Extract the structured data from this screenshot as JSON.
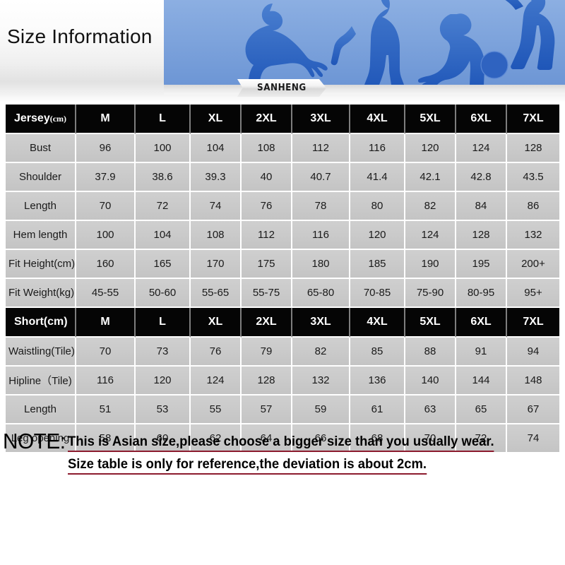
{
  "banner": {
    "title": "Size Information",
    "logo": "SANHENG",
    "accent_blue": "#7ba2db",
    "art_description": "basketball-player-silhouettes"
  },
  "jersey_table": {
    "header": {
      "label": "Jersey",
      "unit": "(cm)",
      "sizes": [
        "M",
        "L",
        "XL",
        "2XL",
        "3XL",
        "4XL",
        "5XL",
        "6XL",
        "7XL"
      ]
    },
    "rows": [
      {
        "label": "Bust",
        "values": [
          "96",
          "100",
          "104",
          "108",
          "112",
          "116",
          "120",
          "124",
          "128"
        ]
      },
      {
        "label": "Shoulder",
        "values": [
          "37.9",
          "38.6",
          "39.3",
          "40",
          "40.7",
          "41.4",
          "42.1",
          "42.8",
          "43.5"
        ]
      },
      {
        "label": "Length",
        "values": [
          "70",
          "72",
          "74",
          "76",
          "78",
          "80",
          "82",
          "84",
          "86"
        ]
      },
      {
        "label": "Hem length",
        "values": [
          "100",
          "104",
          "108",
          "112",
          "116",
          "120",
          "124",
          "128",
          "132"
        ]
      },
      {
        "label": "Fit Height(cm)",
        "values": [
          "160",
          "165",
          "170",
          "175",
          "180",
          "185",
          "190",
          "195",
          "200+"
        ]
      },
      {
        "label": "Fit Weight(kg)",
        "values": [
          "45-55",
          "50-60",
          "55-65",
          "55-75",
          "65-80",
          "70-85",
          "75-90",
          "80-95",
          "95+"
        ]
      }
    ]
  },
  "short_table": {
    "header": {
      "label": "Short(cm)",
      "sizes": [
        "M",
        "L",
        "XL",
        "2XL",
        "3XL",
        "4XL",
        "5XL",
        "6XL",
        "7XL"
      ]
    },
    "rows": [
      {
        "label": "Waistling(Tile)",
        "values": [
          "70",
          "73",
          "76",
          "79",
          "82",
          "85",
          "88",
          "91",
          "94"
        ]
      },
      {
        "label": "Hipline（Tile)",
        "values": [
          "116",
          "120",
          "124",
          "128",
          "132",
          "136",
          "140",
          "144",
          "148"
        ]
      },
      {
        "label": "Length",
        "values": [
          "51",
          "53",
          "55",
          "57",
          "59",
          "61",
          "63",
          "65",
          "67"
        ]
      },
      {
        "label": "Leg opening",
        "values": [
          "58",
          "60",
          "62",
          "64",
          "66",
          "68",
          "70",
          "72",
          "74"
        ]
      }
    ]
  },
  "note": {
    "label": "NOTE:",
    "line1": "This is Asian size,please choose a bigger size than you usually wear.",
    "line2": "Size table is only for reference,the deviation is about 2cm.",
    "underline_color": "#8c1b2e"
  }
}
